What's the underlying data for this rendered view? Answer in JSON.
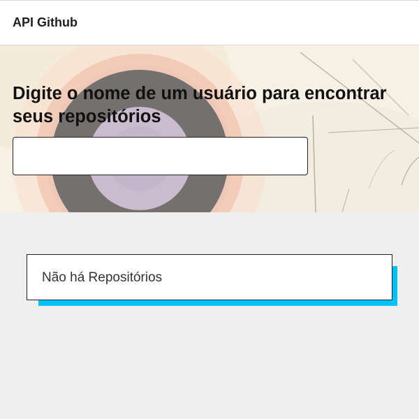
{
  "header": {
    "title": "API Github"
  },
  "hero": {
    "heading": "Digite o nome de um usuário para encontrar seus repositórios",
    "search": {
      "value": "",
      "placeholder": ""
    }
  },
  "repos": {
    "empty_message": "Não há Repositórios",
    "accent_color": "#00c2ff"
  },
  "colors": {
    "page_background": "#efefef",
    "header_background": "#ffffff",
    "card_shadow": "#00c2ff"
  }
}
